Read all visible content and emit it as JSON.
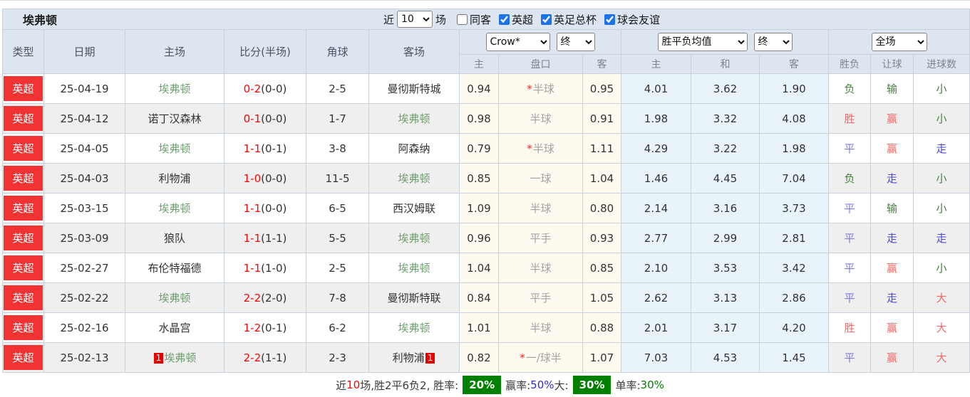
{
  "title": "埃弗顿",
  "toolbar": {
    "near_label": "近",
    "near_value": "10",
    "games_label": "场",
    "filters": [
      {
        "label": "同客",
        "checked": false
      },
      {
        "label": "英超",
        "checked": true
      },
      {
        "label": "英足总杯",
        "checked": true
      },
      {
        "label": "球会友谊",
        "checked": true
      }
    ]
  },
  "header": {
    "columns": [
      "类型",
      "日期",
      "主场",
      "比分(半场)",
      "角球",
      "客场"
    ],
    "odds_source_select": "Crow*",
    "odds_time_select": "终",
    "avg_select": "胜平负均值",
    "avg_time_select": "终",
    "result_select": "全场",
    "sub_columns": [
      "主",
      "盘口",
      "客",
      "主",
      "和",
      "客",
      "胜负",
      "让球",
      "进球数"
    ]
  },
  "red_card_label": "1",
  "colors": {
    "win": "#ef6a6a",
    "draw": "#7b7be0",
    "walk": "#4949d2",
    "lose": "#46803f",
    "league_badge": "#f23333",
    "everton_green": "#6f9e6f",
    "score_red": "#ff0000",
    "badge_green": "#008000"
  },
  "rows": [
    {
      "league": "英超",
      "date": "25-04-19",
      "home": "埃弗顿",
      "home_everton": true,
      "home_card": false,
      "score": "0-2",
      "half": "(0-0)",
      "corners": "2-5",
      "away": "曼彻斯特城",
      "away_everton": false,
      "away_card": false,
      "asian_home": "0.94",
      "handicap_star": true,
      "handicap": "半球",
      "asian_away": "0.95",
      "avg_home": "4.01",
      "avg_draw": "3.62",
      "avg_away": "1.90",
      "outcome": "负",
      "outcome_tone": "lose",
      "let": "输",
      "let_tone": "lose",
      "goals": "小",
      "goals_tone": "lose"
    },
    {
      "league": "英超",
      "date": "25-04-12",
      "home": "诺丁汉森林",
      "home_everton": false,
      "home_card": false,
      "score": "0-1",
      "half": "(0-0)",
      "corners": "1-7",
      "away": "埃弗顿",
      "away_everton": true,
      "away_card": false,
      "asian_home": "0.98",
      "handicap_star": false,
      "handicap": "半球",
      "asian_away": "0.91",
      "avg_home": "1.98",
      "avg_draw": "3.32",
      "avg_away": "4.08",
      "outcome": "胜",
      "outcome_tone": "win",
      "let": "赢",
      "let_tone": "win",
      "goals": "小",
      "goals_tone": "lose"
    },
    {
      "league": "英超",
      "date": "25-04-05",
      "home": "埃弗顿",
      "home_everton": true,
      "home_card": false,
      "score": "1-1",
      "half": "(0-1)",
      "corners": "3-8",
      "away": "阿森纳",
      "away_everton": false,
      "away_card": false,
      "asian_home": "0.79",
      "handicap_star": true,
      "handicap": "半球",
      "asian_away": "1.11",
      "avg_home": "4.29",
      "avg_draw": "3.22",
      "avg_away": "1.98",
      "outcome": "平",
      "outcome_tone": "draw",
      "let": "赢",
      "let_tone": "win",
      "goals": "走",
      "goals_tone": "walk"
    },
    {
      "league": "英超",
      "date": "25-04-03",
      "home": "利物浦",
      "home_everton": false,
      "home_card": false,
      "score": "1-0",
      "half": "(0-0)",
      "corners": "11-5",
      "away": "埃弗顿",
      "away_everton": true,
      "away_card": false,
      "asian_home": "0.85",
      "handicap_star": false,
      "handicap": "一球",
      "asian_away": "1.04",
      "avg_home": "1.46",
      "avg_draw": "4.45",
      "avg_away": "7.04",
      "outcome": "负",
      "outcome_tone": "lose",
      "let": "走",
      "let_tone": "walk",
      "goals": "小",
      "goals_tone": "lose"
    },
    {
      "league": "英超",
      "date": "25-03-15",
      "home": "埃弗顿",
      "home_everton": true,
      "home_card": false,
      "score": "1-1",
      "half": "(0-0)",
      "corners": "6-5",
      "away": "西汉姆联",
      "away_everton": false,
      "away_card": false,
      "asian_home": "1.09",
      "handicap_star": false,
      "handicap": "半球",
      "asian_away": "0.80",
      "avg_home": "2.14",
      "avg_draw": "3.16",
      "avg_away": "3.73",
      "outcome": "平",
      "outcome_tone": "draw",
      "let": "输",
      "let_tone": "lose",
      "goals": "小",
      "goals_tone": "lose"
    },
    {
      "league": "英超",
      "date": "25-03-09",
      "home": "狼队",
      "home_everton": false,
      "home_card": false,
      "score": "1-1",
      "half": "(1-1)",
      "corners": "5-5",
      "away": "埃弗顿",
      "away_everton": true,
      "away_card": false,
      "asian_home": "0.96",
      "handicap_star": false,
      "handicap": "平手",
      "asian_away": "0.93",
      "avg_home": "2.77",
      "avg_draw": "2.99",
      "avg_away": "2.81",
      "outcome": "平",
      "outcome_tone": "draw",
      "let": "走",
      "let_tone": "walk",
      "goals": "走",
      "goals_tone": "walk"
    },
    {
      "league": "英超",
      "date": "25-02-27",
      "home": "布伦特福德",
      "home_everton": false,
      "home_card": false,
      "score": "1-1",
      "half": "(1-0)",
      "corners": "2-5",
      "away": "埃弗顿",
      "away_everton": true,
      "away_card": false,
      "asian_home": "1.04",
      "handicap_star": false,
      "handicap": "半球",
      "asian_away": "0.85",
      "avg_home": "2.10",
      "avg_draw": "3.53",
      "avg_away": "3.42",
      "outcome": "平",
      "outcome_tone": "draw",
      "let": "赢",
      "let_tone": "win",
      "goals": "小",
      "goals_tone": "lose"
    },
    {
      "league": "英超",
      "date": "25-02-22",
      "home": "埃弗顿",
      "home_everton": true,
      "home_card": false,
      "score": "2-2",
      "half": "(2-0)",
      "corners": "7-8",
      "away": "曼彻斯特联",
      "away_everton": false,
      "away_card": false,
      "asian_home": "0.84",
      "handicap_star": false,
      "handicap": "平手",
      "asian_away": "1.05",
      "avg_home": "2.62",
      "avg_draw": "3.13",
      "avg_away": "2.86",
      "outcome": "平",
      "outcome_tone": "draw",
      "let": "走",
      "let_tone": "walk",
      "goals": "大",
      "goals_tone": "win"
    },
    {
      "league": "英超",
      "date": "25-02-16",
      "home": "水晶宫",
      "home_everton": false,
      "home_card": false,
      "score": "1-2",
      "half": "(0-1)",
      "corners": "6-2",
      "away": "埃弗顿",
      "away_everton": true,
      "away_card": false,
      "asian_home": "1.01",
      "handicap_star": false,
      "handicap": "半球",
      "asian_away": "0.88",
      "avg_home": "2.01",
      "avg_draw": "3.17",
      "avg_away": "4.20",
      "outcome": "胜",
      "outcome_tone": "win",
      "let": "赢",
      "let_tone": "win",
      "goals": "大",
      "goals_tone": "win"
    },
    {
      "league": "英超",
      "date": "25-02-13",
      "home": "埃弗顿",
      "home_everton": true,
      "home_card": true,
      "score": "2-2",
      "half": "(1-1)",
      "corners": "2-3",
      "away": "利物浦",
      "away_everton": false,
      "away_card": true,
      "asian_home": "0.82",
      "handicap_star": true,
      "handicap": "一/球半",
      "asian_away": "1.07",
      "avg_home": "7.03",
      "avg_draw": "4.53",
      "avg_away": "1.45",
      "outcome": "平",
      "outcome_tone": "draw",
      "let": "赢",
      "let_tone": "win",
      "goals": "大",
      "goals_tone": "win"
    }
  ],
  "footer": {
    "segments": [
      {
        "name": "near-label",
        "text": "近",
        "style": "plain"
      },
      {
        "name": "near-count",
        "text": "10",
        "style": "red"
      },
      {
        "name": "record-text",
        "text": "场,胜2平6负2, 胜率:",
        "style": "plain"
      },
      {
        "name": "win-rate-badge",
        "text": "20%",
        "style": "badge"
      },
      {
        "name": "handicap-rate-label",
        "text": "赢率:",
        "style": "plain"
      },
      {
        "name": "handicap-rate-value",
        "text": "50%",
        "style": "blue"
      },
      {
        "name": "big-goals-label",
        "text": " 大:",
        "style": "plain"
      },
      {
        "name": "big-goals-badge",
        "text": "30%",
        "style": "badge"
      },
      {
        "name": "single-rate-label",
        "text": "单率:",
        "style": "plain"
      },
      {
        "name": "single-rate-value",
        "text": "30%",
        "style": "green"
      }
    ]
  }
}
